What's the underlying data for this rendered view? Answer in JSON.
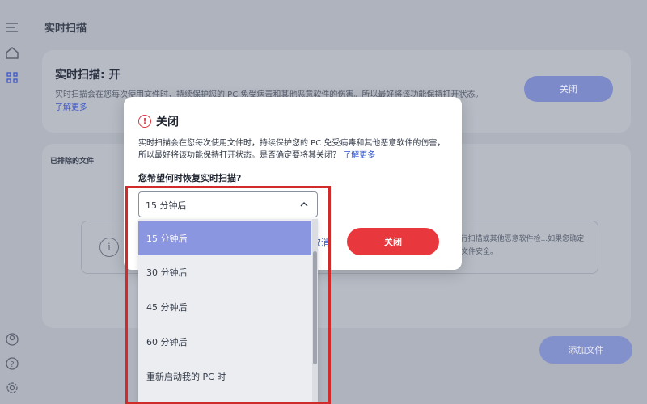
{
  "app": {
    "page_title": "实时扫描",
    "top_card": {
      "title": "实时扫描: 开",
      "description": "实时扫描会在您每次使用文件时，持续保护您的 PC 免受病毒和其他恶意软件的伤害。所以最好将该功能保持打开状态。",
      "learn_more": "了解更多",
      "close_button": "关闭"
    },
    "bottom_card": {
      "title": "已排除的文件",
      "info_text": "...行扫描或其他恶意软件检...如果您确定此文件安全。",
      "add_file_button": "添加文件"
    }
  },
  "dialog": {
    "title": "关闭",
    "body": "实时扫描会在您每次使用文件时，持续保护您的 PC 免受病毒和其他恶意软件的伤害，所以最好将该功能保持打开状态。是否确定要将其关闭？",
    "learn_more": "了解更多",
    "question": "您希望何时恢复实时扫描?",
    "select": {
      "value": "15 分钟后",
      "options": [
        "15 分钟后",
        "30 分钟后",
        "45 分钟后",
        "60 分钟后",
        "重新启动我的 PC 时"
      ]
    },
    "cancel_label": "取消",
    "confirm_label": "关闭"
  },
  "colors": {
    "accent": "#8b96e0",
    "danger": "#e8383d",
    "highlight": "#d12a2a"
  },
  "icons": [
    "menu-icon",
    "home-icon",
    "apps-icon",
    "account-icon",
    "help-icon",
    "settings-icon",
    "info-icon",
    "warning-icon",
    "chevron-up-icon"
  ]
}
